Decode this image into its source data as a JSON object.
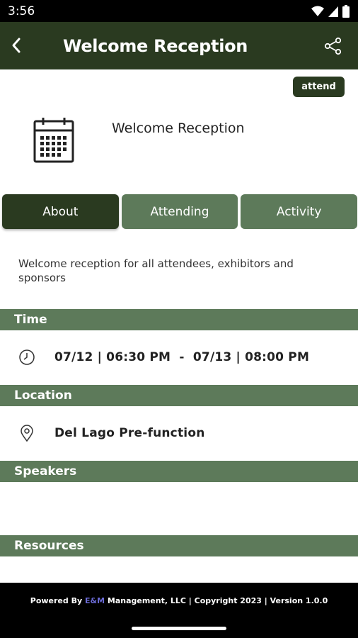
{
  "status_bar": {
    "time": "3:56"
  },
  "app_bar": {
    "title": "Welcome Reception"
  },
  "attend_button": {
    "label": "attend"
  },
  "event": {
    "name": "Welcome Reception",
    "description": "Welcome reception for all attendees, exhibitors and sponsors"
  },
  "tabs": [
    {
      "label": "About",
      "active": true
    },
    {
      "label": "Attending",
      "active": false
    },
    {
      "label": "Activity",
      "active": false
    }
  ],
  "sections": {
    "time": {
      "header": "Time",
      "value": "07/12 | 06:30 PM  -  07/13 | 08:00 PM"
    },
    "location": {
      "header": "Location",
      "value": "Del Lago Pre-function"
    },
    "speakers": {
      "header": "Speakers"
    },
    "resources": {
      "header": "Resources"
    }
  },
  "footer": {
    "prefix": "Powered By ",
    "brand": "E&M",
    "suffix": " Management, LLC | Copyright 2023 | Version 1.0.0"
  },
  "colors": {
    "primary_dark": "#2a3a20",
    "primary_muted": "#5d7a5a",
    "brand_link": "#6b6bd6"
  },
  "icons": [
    "wifi-icon",
    "signal-icon",
    "battery-icon",
    "back-arrow-icon",
    "share-icon",
    "calendar-icon",
    "clock-icon",
    "location-pin-icon"
  ]
}
